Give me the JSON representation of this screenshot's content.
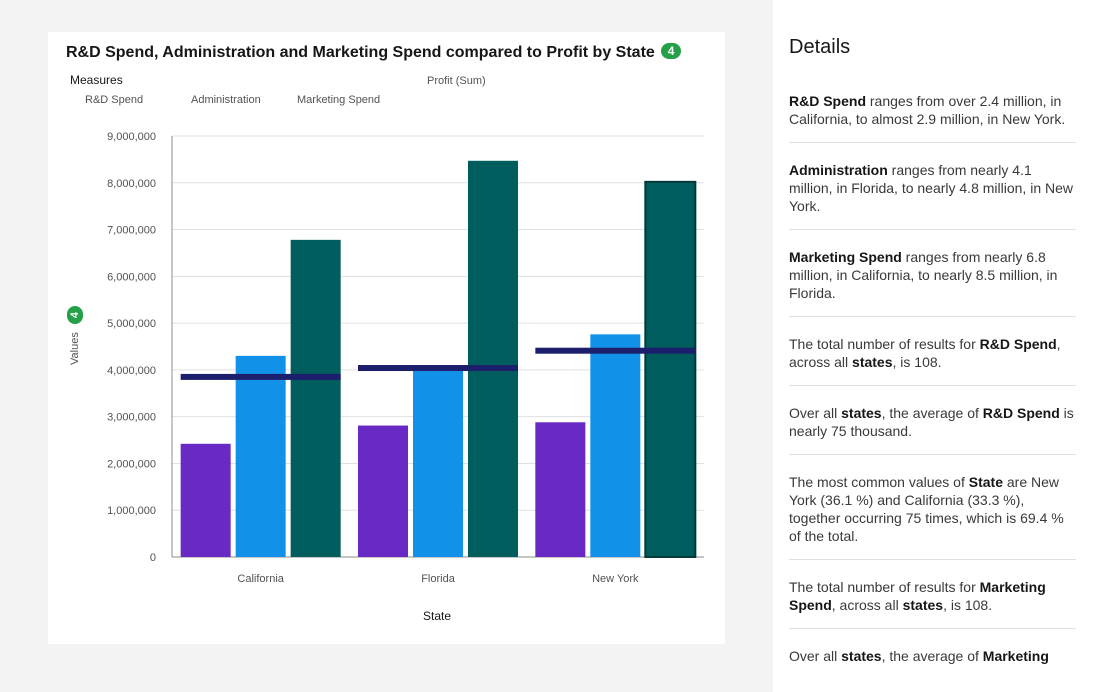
{
  "chart": {
    "title": "R&D Spend, Administration and Marketing Spend compared to Profit by State",
    "badge": "4",
    "legend_title": "Measures",
    "legend_items": [
      "R&D Spend",
      "Administration",
      "Marketing Spend"
    ],
    "profit_legend": "Profit (Sum)",
    "y_axis_title": "Values",
    "y_badge": "4",
    "x_axis_title": "State"
  },
  "chart_data": {
    "type": "bar",
    "title": "R&D Spend, Administration and Marketing Spend compared to Profit by State",
    "xlabel": "State",
    "ylabel": "Values",
    "categories": [
      "California",
      "Florida",
      "New York"
    ],
    "series": [
      {
        "name": "R&D Spend",
        "color": "#6929c4",
        "values": [
          2420000,
          2810000,
          2880000
        ]
      },
      {
        "name": "Administration",
        "color": "#1192e8",
        "values": [
          4300000,
          4090000,
          4760000
        ]
      },
      {
        "name": "Marketing Spend",
        "color": "#005d5d",
        "values": [
          6780000,
          8470000,
          8020000
        ]
      }
    ],
    "line_series": {
      "name": "Profit (Sum)",
      "color": "#1c1f6b",
      "values": [
        3850000,
        4040000,
        4410000
      ]
    },
    "ylim": [
      0,
      9000000
    ],
    "yticks": [
      0,
      1000000,
      2000000,
      3000000,
      4000000,
      5000000,
      6000000,
      7000000,
      8000000,
      9000000
    ],
    "ytick_labels": [
      "0",
      "1,000,000",
      "2,000,000",
      "3,000,000",
      "4,000,000",
      "5,000,000",
      "6,000,000",
      "7,000,000",
      "8,000,000",
      "9,000,000"
    ],
    "grid": true
  },
  "details": {
    "title": "Details",
    "insights": [
      {
        "parts": [
          [
            "b",
            "R&D Spend"
          ],
          [
            "t",
            " ranges from over 2.4 million, in California, to almost 2.9 million, in New York."
          ]
        ]
      },
      {
        "parts": [
          [
            "b",
            "Administration"
          ],
          [
            "t",
            " ranges from nearly 4.1 million, in Florida, to nearly 4.8 million, in New York."
          ]
        ]
      },
      {
        "parts": [
          [
            "b",
            "Marketing Spend"
          ],
          [
            "t",
            " ranges from nearly 6.8 million, in California, to nearly 8.5 million, in Florida."
          ]
        ]
      },
      {
        "parts": [
          [
            "t",
            "The total number of results for "
          ],
          [
            "b",
            "R&D Spend"
          ],
          [
            "t",
            ", across all "
          ],
          [
            "b",
            "states"
          ],
          [
            "t",
            ", is 108."
          ]
        ]
      },
      {
        "parts": [
          [
            "t",
            "Over all "
          ],
          [
            "b",
            "states"
          ],
          [
            "t",
            ", the average of "
          ],
          [
            "b",
            "R&D Spend"
          ],
          [
            "t",
            " is nearly 75 thousand."
          ]
        ]
      },
      {
        "parts": [
          [
            "t",
            "The most common values of "
          ],
          [
            "b",
            "State"
          ],
          [
            "t",
            " are New York (36.1 %) and California (33.3 %), together occurring 75 times, which is 69.4 % of the total."
          ]
        ]
      },
      {
        "parts": [
          [
            "t",
            "The total number of results for "
          ],
          [
            "b",
            "Marketing Spend"
          ],
          [
            "t",
            ", across all "
          ],
          [
            "b",
            "states"
          ],
          [
            "t",
            ", is 108."
          ]
        ]
      },
      {
        "parts": [
          [
            "t",
            "Over all "
          ],
          [
            "b",
            "states"
          ],
          [
            "t",
            ", the average of "
          ],
          [
            "b",
            "Marketing"
          ]
        ]
      }
    ]
  }
}
